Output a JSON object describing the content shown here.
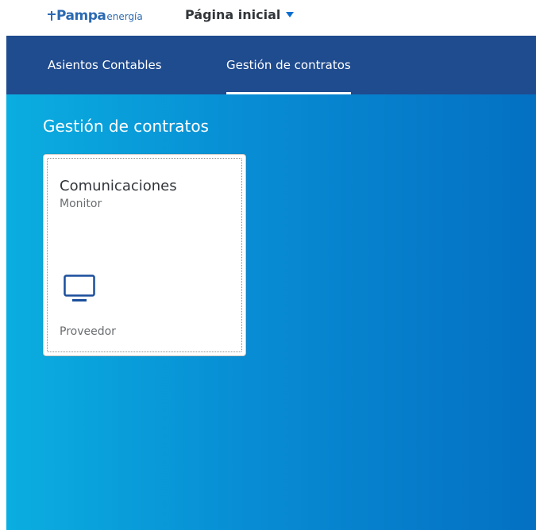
{
  "header": {
    "logo_main": "Pampa",
    "logo_sub": "energía",
    "home_label": "Página inicial"
  },
  "tabs": [
    {
      "label": "Asientos Contables",
      "active": false
    },
    {
      "label": "Gestión de contratos",
      "active": true
    }
  ],
  "main": {
    "section_title": "Gestión de contratos",
    "tile": {
      "title": "Comunicaciones",
      "subtitle": "Monitor",
      "icon": "monitor-icon",
      "footer": "Proveedor"
    }
  },
  "colors": {
    "tabbar_bg": "#1f4b8f",
    "brand_blue": "#2b6ab3",
    "icon_blue": "#1b4f9c",
    "gradient_start": "#0aaee0",
    "gradient_end": "#0470c2"
  }
}
